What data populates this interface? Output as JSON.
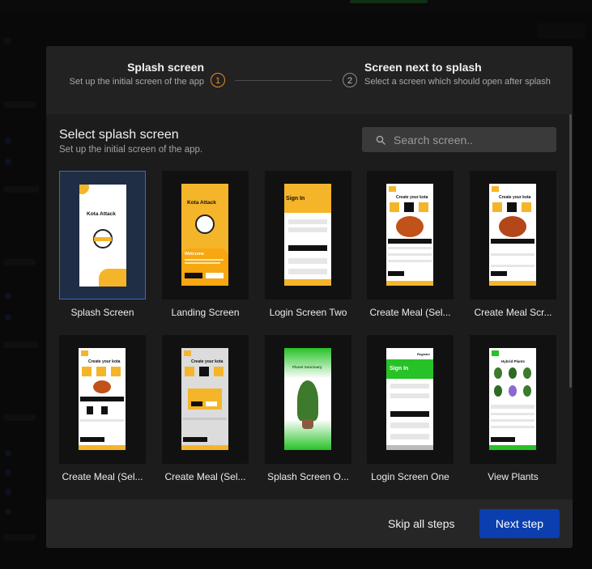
{
  "stepper": {
    "step1": {
      "number": "1",
      "title": "Splash screen",
      "subtitle": "Set up the initial screen of the app",
      "state": "active"
    },
    "step2": {
      "number": "2",
      "title": "Screen next to splash",
      "subtitle": "Select a screen which should open after splash",
      "state": "pending"
    }
  },
  "section": {
    "title": "Select splash screen",
    "subtitle": "Set up the initial screen of the app."
  },
  "search": {
    "placeholder": "Search screen..",
    "icon": "search-icon"
  },
  "screens": [
    {
      "label": "Splash Screen",
      "selected": true
    },
    {
      "label": "Landing Screen",
      "selected": false
    },
    {
      "label": "Login Screen Two",
      "selected": false
    },
    {
      "label": "Create Meal (Sel...",
      "selected": false
    },
    {
      "label": "Create Meal Scr...",
      "selected": false
    },
    {
      "label": "Create Meal (Sel...",
      "selected": false
    },
    {
      "label": "Create Meal (Sel...",
      "selected": false
    },
    {
      "label": "Splash Screen O...",
      "selected": false
    },
    {
      "label": "Login Screen One",
      "selected": false
    },
    {
      "label": "View Plants",
      "selected": false
    }
  ],
  "previews": {
    "app_name": "Kota Attack",
    "welcome": "Welcome",
    "sign_in": "Sign In",
    "register": "Register",
    "create_your_kota": "Create your kota",
    "planet_sanctuary": "Planet Sanctuary",
    "hybrid_plants": "Hybrid Plants"
  },
  "footer": {
    "skip_label": "Skip all steps",
    "next_label": "Next step"
  },
  "colors": {
    "accent": "#0b3fb0",
    "selected_border": "#3c68c8",
    "step_active": "#e0902a",
    "brand_yellow": "#f5b52a",
    "brand_green": "#27c227"
  }
}
